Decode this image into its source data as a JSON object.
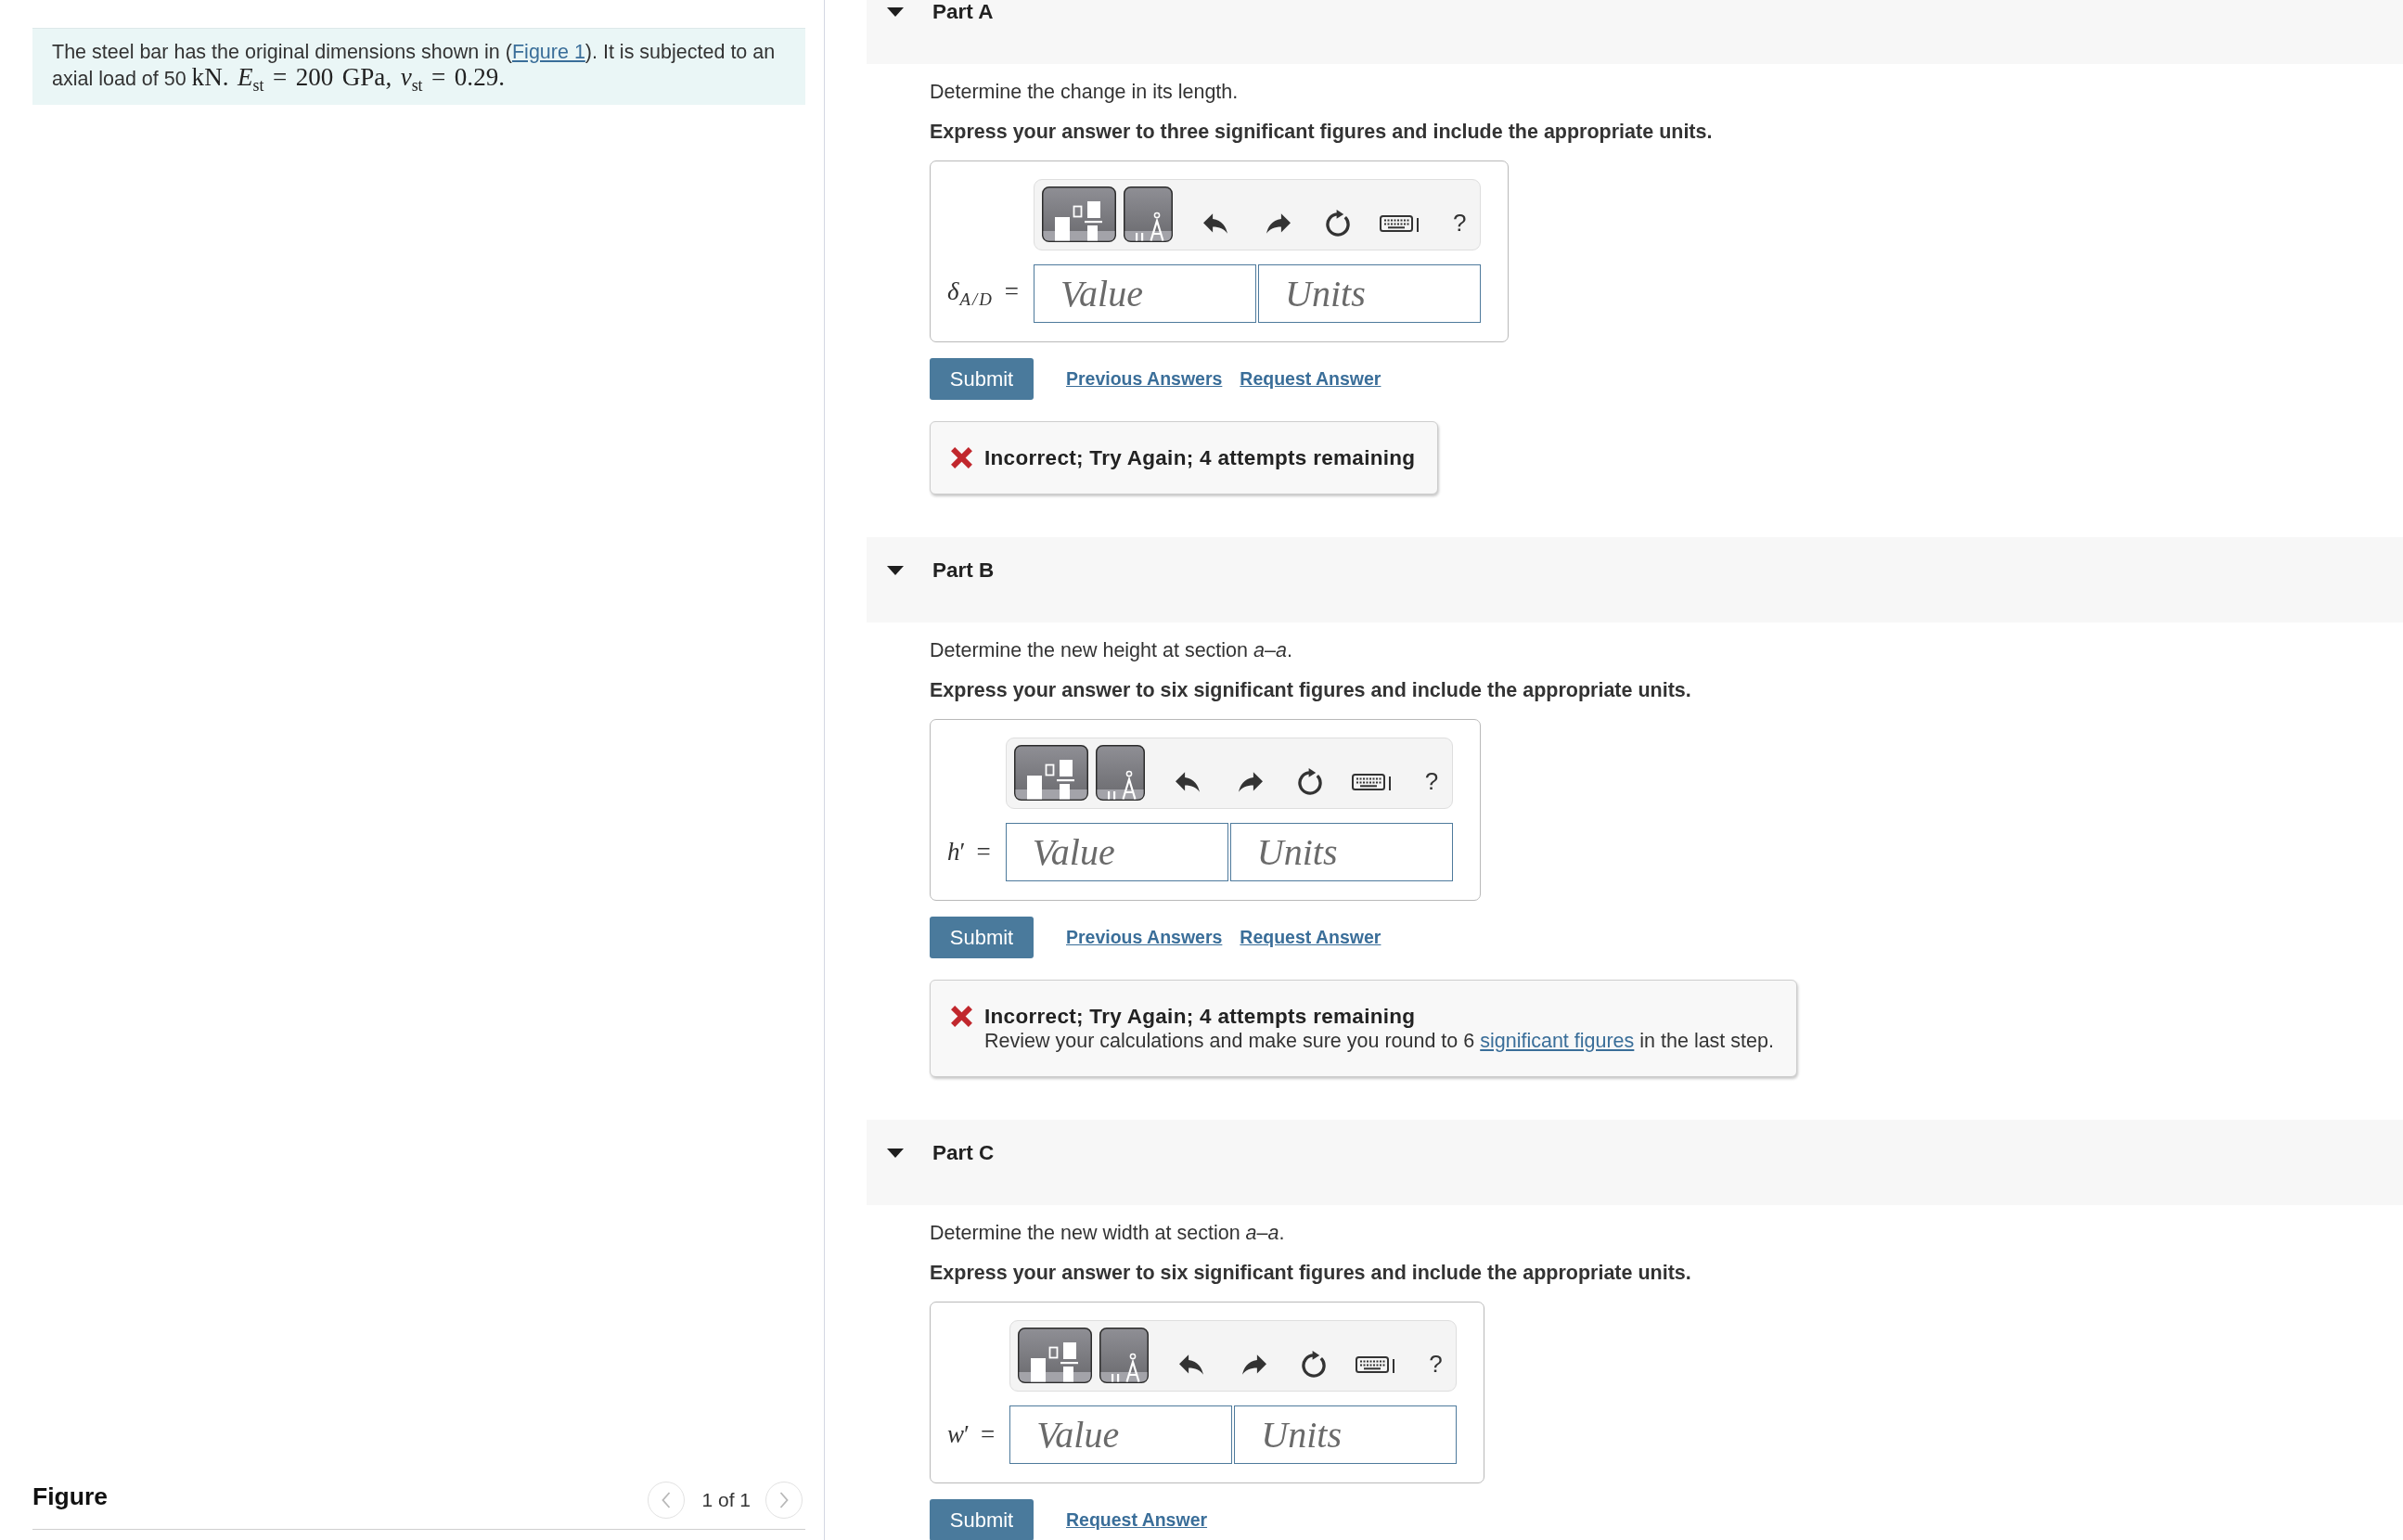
{
  "problem": {
    "statement": [
      {
        "kind": "text",
        "text": "The steel bar has the original dimensions shown in ("
      },
      {
        "kind": "link",
        "text": "Figure 1"
      },
      {
        "kind": "text",
        "text": "). It is subjected to an axial load of 50 "
      },
      {
        "kind": "math",
        "text": "kN. *E*$_{st}$ = 200 GPa, *ν*$_{st}$ = 0.29."
      }
    ]
  },
  "figure_panel": {
    "title": "Figure",
    "counter": "1 of 1"
  },
  "parts": [
    {
      "title": "Part A",
      "expanded": true,
      "prompt": "Determine the change in its length.",
      "instruction": "Express your answer to three significant figures and include the appropriate units.",
      "answer": {
        "label": "*δ*$_{A/D}$ =",
        "value_placeholder": "Value",
        "units_placeholder": "Units",
        "help": "?"
      },
      "actions": {
        "submit": "Submit",
        "links": [
          "Previous Answers",
          "Request Answer"
        ]
      },
      "feedback": {
        "kind": "incorrect",
        "title": "Incorrect; Try Again; 4 attempts remaining"
      }
    },
    {
      "title": "Part B",
      "expanded": true,
      "prompt": "Determine the new height at section *a*–*a*.",
      "instruction": "Express your answer to six significant figures and include the appropriate units.",
      "answer": {
        "label": "*h*′ =",
        "value_placeholder": "Value",
        "units_placeholder": "Units",
        "help": "?"
      },
      "actions": {
        "submit": "Submit",
        "links": [
          "Previous Answers",
          "Request Answer"
        ]
      },
      "feedback": {
        "kind": "incorrect",
        "title": "Incorrect; Try Again; 4 attempts remaining",
        "detail": [
          {
            "kind": "text",
            "text": "Review your calculations and make sure you round to 6 "
          },
          {
            "kind": "link",
            "text": "significant figures"
          },
          {
            "kind": "text",
            "text": " in the last step."
          }
        ]
      }
    },
    {
      "title": "Part C",
      "expanded": true,
      "prompt": "Determine the new width at section *a*–*a*.",
      "instruction": "Express your answer to six significant figures and include the appropriate units.",
      "answer": {
        "label": "*w*′ =",
        "value_placeholder": "Value",
        "units_placeholder": "Units",
        "help": "?"
      },
      "actions": {
        "submit": "Submit",
        "links": [
          "Request Answer"
        ]
      }
    }
  ]
}
